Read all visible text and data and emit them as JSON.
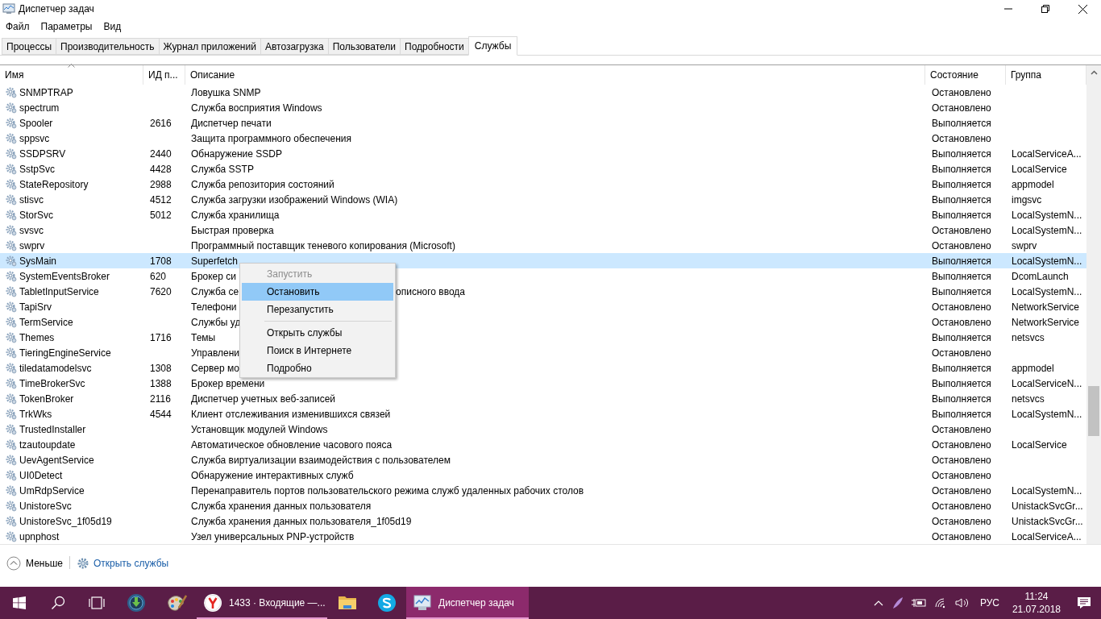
{
  "window": {
    "title": "Диспетчер задач"
  },
  "menu": [
    "Файл",
    "Параметры",
    "Вид"
  ],
  "tabs": [
    {
      "label": "Процессы",
      "selected": false
    },
    {
      "label": "Производительность",
      "selected": false
    },
    {
      "label": "Журнал приложений",
      "selected": false
    },
    {
      "label": "Автозагрузка",
      "selected": false
    },
    {
      "label": "Пользователи",
      "selected": false
    },
    {
      "label": "Подробности",
      "selected": false
    },
    {
      "label": "Службы",
      "selected": true
    }
  ],
  "table": {
    "columns": [
      {
        "label": "Имя",
        "sorted": true
      },
      {
        "label": "ИД п...",
        "sorted": false
      },
      {
        "label": "Описание",
        "sorted": false
      },
      {
        "label": "Состояние",
        "sorted": false
      },
      {
        "label": "Группа",
        "sorted": false
      }
    ],
    "rows": [
      {
        "name": "SNMPTRAP",
        "pid": "",
        "description": "Ловушка SNMP",
        "status": "Остановлено",
        "group": "",
        "selected": false
      },
      {
        "name": "spectrum",
        "pid": "",
        "description": "Служба восприятия Windows",
        "status": "Остановлено",
        "group": "",
        "selected": false
      },
      {
        "name": "Spooler",
        "pid": "2616",
        "description": "Диспетчер печати",
        "status": "Выполняется",
        "group": "",
        "selected": false
      },
      {
        "name": "sppsvc",
        "pid": "",
        "description": "Защита программного обеспечения",
        "status": "Остановлено",
        "group": "",
        "selected": false
      },
      {
        "name": "SSDPSRV",
        "pid": "2440",
        "description": "Обнаружение SSDP",
        "status": "Выполняется",
        "group": "LocalServiceA...",
        "selected": false
      },
      {
        "name": "SstpSvc",
        "pid": "4428",
        "description": "Служба SSTP",
        "status": "Выполняется",
        "group": "LocalService",
        "selected": false
      },
      {
        "name": "StateRepository",
        "pid": "2988",
        "description": "Служба репозитория состояний",
        "status": "Выполняется",
        "group": "appmodel",
        "selected": false
      },
      {
        "name": "stisvc",
        "pid": "4512",
        "description": "Служба загрузки изображений Windows (WIA)",
        "status": "Выполняется",
        "group": "imgsvc",
        "selected": false
      },
      {
        "name": "StorSvc",
        "pid": "5012",
        "description": "Служба хранилища",
        "status": "Выполняется",
        "group": "LocalSystemN...",
        "selected": false
      },
      {
        "name": "svsvc",
        "pid": "",
        "description": "Быстрая проверка",
        "status": "Остановлено",
        "group": "LocalSystemN...",
        "selected": false
      },
      {
        "name": "swprv",
        "pid": "",
        "description": "Программный поставщик теневого копирования (Microsoft)",
        "status": "Остановлено",
        "group": "swprv",
        "selected": false
      },
      {
        "name": "SysMain",
        "pid": "1708",
        "description": "Superfetch",
        "status": "Выполняется",
        "group": "LocalSystemN...",
        "selected": true
      },
      {
        "name": "SystemEventsBroker",
        "pid": "620",
        "description": "Брокер си",
        "status": "Выполняется",
        "group": "DcomLaunch",
        "selected": false
      },
      {
        "name": "TabletInputService",
        "pid": "7620",
        "description": "Служба се",
        "description_after_menu": "описного ввода",
        "status": "Выполняется",
        "group": "LocalSystemN...",
        "selected": false
      },
      {
        "name": "TapiSrv",
        "pid": "",
        "description": "Телефони",
        "status": "Остановлено",
        "group": "NetworkService",
        "selected": false
      },
      {
        "name": "TermService",
        "pid": "",
        "description": "Службы уд",
        "status": "Остановлено",
        "group": "NetworkService",
        "selected": false
      },
      {
        "name": "Themes",
        "pid": "1716",
        "description": "Темы",
        "status": "Выполняется",
        "group": "netsvcs",
        "selected": false
      },
      {
        "name": "TieringEngineService",
        "pid": "",
        "description": "Управлени",
        "status": "Остановлено",
        "group": "",
        "selected": false
      },
      {
        "name": "tiledatamodelsvc",
        "pid": "1308",
        "description": "Сервер мо",
        "status": "Выполняется",
        "group": "appmodel",
        "selected": false
      },
      {
        "name": "TimeBrokerSvc",
        "pid": "1388",
        "description": "Брокер времени",
        "status": "Выполняется",
        "group": "LocalServiceN...",
        "selected": false
      },
      {
        "name": "TokenBroker",
        "pid": "2116",
        "description": "Диспетчер учетных веб-записей",
        "status": "Выполняется",
        "group": "netsvcs",
        "selected": false
      },
      {
        "name": "TrkWks",
        "pid": "4544",
        "description": "Клиент отслеживания изменившихся связей",
        "status": "Выполняется",
        "group": "LocalSystemN...",
        "selected": false
      },
      {
        "name": "TrustedInstaller",
        "pid": "",
        "description": "Установщик модулей Windows",
        "status": "Остановлено",
        "group": "",
        "selected": false
      },
      {
        "name": "tzautoupdate",
        "pid": "",
        "description": "Автоматическое обновление часового пояса",
        "status": "Остановлено",
        "group": "LocalService",
        "selected": false
      },
      {
        "name": "UevAgentService",
        "pid": "",
        "description": "Служба виртуализации взаимодействия с пользователем",
        "status": "Остановлено",
        "group": "",
        "selected": false
      },
      {
        "name": "UI0Detect",
        "pid": "",
        "description": "Обнаружение интерактивных служб",
        "status": "Остановлено",
        "group": "",
        "selected": false
      },
      {
        "name": "UmRdpService",
        "pid": "",
        "description": "Перенаправитель портов пользовательского режима служб удаленных рабочих столов",
        "status": "Остановлено",
        "group": "LocalSystemN...",
        "selected": false
      },
      {
        "name": "UnistoreSvc",
        "pid": "",
        "description": "Служба хранения данных пользователя",
        "status": "Остановлено",
        "group": "UnistackSvcGr...",
        "selected": false
      },
      {
        "name": "UnistoreSvc_1f05d19",
        "pid": "",
        "description": "Служба хранения данных пользователя_1f05d19",
        "status": "Остановлено",
        "group": "UnistackSvcGr...",
        "selected": false
      },
      {
        "name": "upnphost",
        "pid": "",
        "description": "Узел универсальных PNP-устройств",
        "status": "Остановлено",
        "group": "LocalServiceA...",
        "selected": false
      }
    ]
  },
  "context_menu": {
    "items": [
      {
        "kind": "item",
        "label": "Запустить",
        "disabled": true,
        "highlighted": false
      },
      {
        "kind": "item",
        "label": "Остановить",
        "disabled": false,
        "highlighted": true
      },
      {
        "kind": "item",
        "label": "Перезапустить",
        "disabled": false,
        "highlighted": false
      },
      {
        "kind": "separator"
      },
      {
        "kind": "item",
        "label": "Открыть службы",
        "disabled": false,
        "highlighted": false
      },
      {
        "kind": "item",
        "label": "Поиск в Интернете",
        "disabled": false,
        "highlighted": false
      },
      {
        "kind": "item",
        "label": "Подробно",
        "disabled": false,
        "highlighted": false
      }
    ]
  },
  "footer": {
    "less": "Меньше",
    "open_services": "Открыть службы"
  },
  "taskbar": {
    "apps": [
      {
        "kind": "start",
        "open": false,
        "active": false
      },
      {
        "kind": "search",
        "open": false,
        "active": false
      },
      {
        "kind": "taskview",
        "open": false,
        "active": false
      },
      {
        "kind": "download",
        "open": false,
        "active": false
      },
      {
        "kind": "paint",
        "open": false,
        "active": false
      },
      {
        "kind": "browser",
        "label": "1433 · Входящие —...",
        "open": true,
        "active": false
      },
      {
        "kind": "folder",
        "open": false,
        "active": false
      },
      {
        "kind": "skype",
        "open": false,
        "active": false
      },
      {
        "kind": "taskmgr",
        "label": "Диспетчер задач",
        "open": true,
        "active": true
      }
    ],
    "language": "РУС",
    "time": "11:24",
    "date": "21.07.2018"
  }
}
